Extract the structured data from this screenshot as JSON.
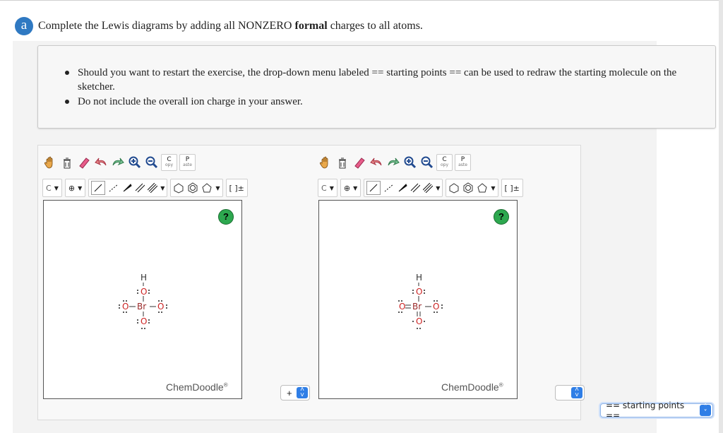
{
  "question": {
    "badge": "a",
    "prompt_before": "Complete the Lewis diagrams by adding all NONZERO ",
    "prompt_bold": "formal",
    "prompt_after": " charges to all atoms."
  },
  "instructions": [
    "Should you want to restart the exercise, the drop-down menu labeled == starting points == can be used to redraw the starting molecule on the sketcher.",
    "Do not include the overall ion charge in your answer."
  ],
  "toolbar": {
    "copy_top": "C",
    "copy_bottom": "opy",
    "paste_top": "P",
    "paste_bottom": "aste",
    "element": "C",
    "charge": "⊕",
    "bracket": "[ ]±"
  },
  "sketchers": [
    {
      "brand": "ChemDoodle",
      "reg": "®",
      "help": "?",
      "molecule": {
        "H": "H",
        "O_top": "O",
        "O_left": "O",
        "Br": "Br",
        "O_right": "O",
        "O_bottom": "O"
      }
    },
    {
      "brand": "ChemDoodle",
      "reg": "®",
      "help": "?",
      "molecule": {
        "H": "H",
        "O_top": "O",
        "O_left": "O",
        "Br": "Br",
        "O_right": "O",
        "O_bottom": "O"
      }
    }
  ],
  "controls": {
    "charge_select_value": "+",
    "empty_select_value": "",
    "starting_points": "== starting points =="
  },
  "colors": {
    "badge": "#2f79c2",
    "help": "#2da84f",
    "spinner": "#2f7ee6",
    "oxygen": "#cc2222"
  }
}
